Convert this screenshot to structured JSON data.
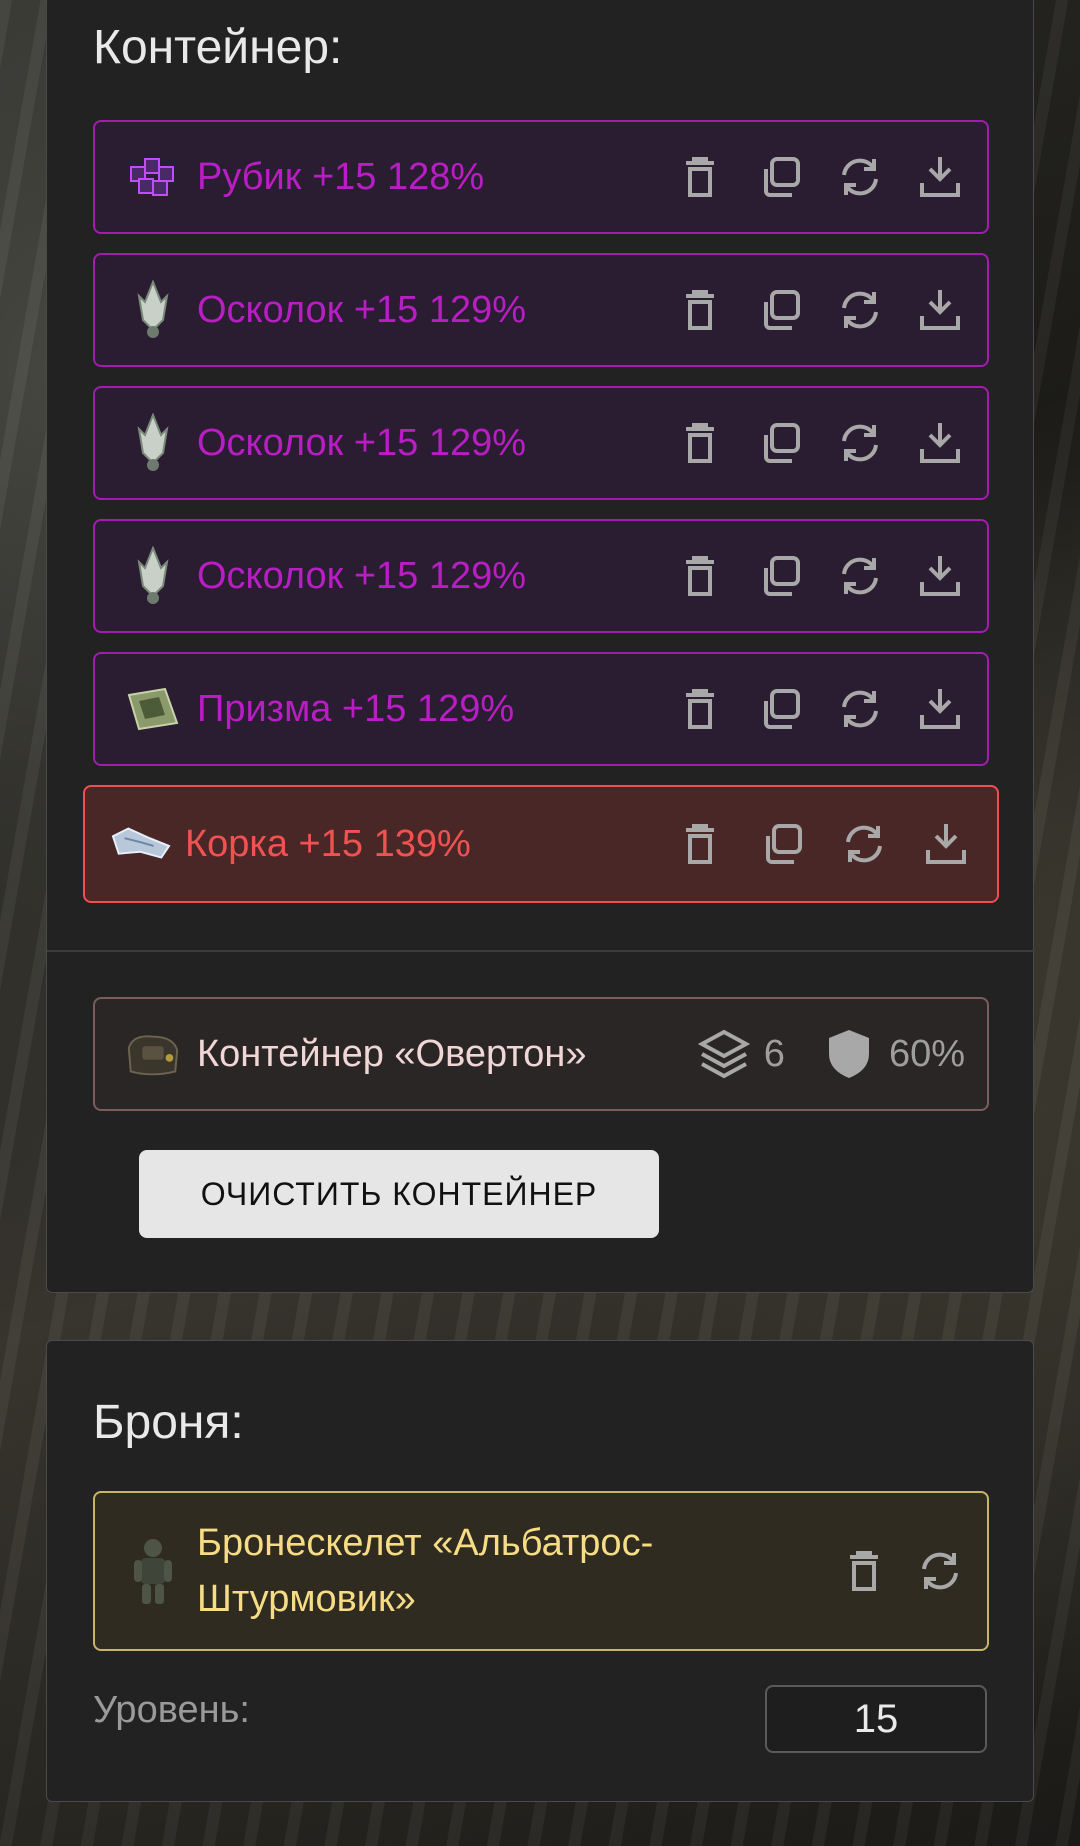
{
  "container_section": {
    "title": "Контейнер:",
    "items": [
      {
        "label": "Рубик +15 128%",
        "icon": "cube-artifact-icon"
      },
      {
        "label": "Осколок +15 129%",
        "icon": "crystal-shard-icon"
      },
      {
        "label": "Осколок +15 129%",
        "icon": "crystal-shard-icon"
      },
      {
        "label": "Осколок +15 129%",
        "icon": "crystal-shard-icon"
      },
      {
        "label": "Призма +15 129%",
        "icon": "prism-artifact-icon"
      },
      {
        "label": "Корка +15 139%",
        "icon": "crust-artifact-icon"
      }
    ],
    "container_card": {
      "label": "Контейнер «Овертон»",
      "slots": "6",
      "protection": "60%"
    },
    "clear_button": "ОЧИСТИТЬ КОНТЕЙНЕР"
  },
  "armor_section": {
    "title": "Броня:",
    "armor": {
      "label": "Бронескелет «Альбатрос-Штурмовик»",
      "icon": "armor-suit-icon"
    },
    "level_label": "Уровень:",
    "level_value": "15"
  },
  "colors": {
    "epic": "#b91dc4",
    "legendary": "#f05252",
    "armor_gold": "#f6dd85",
    "panel_bg": "#222222"
  }
}
